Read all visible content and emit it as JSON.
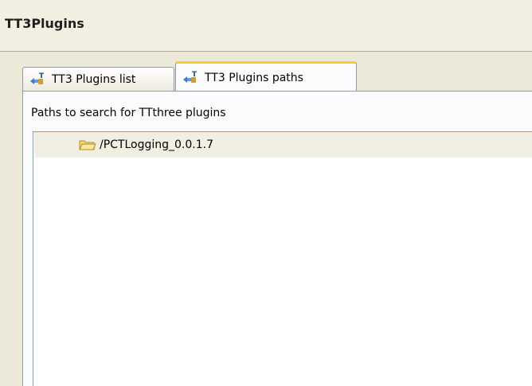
{
  "header": {
    "title": "TT3Plugins"
  },
  "tabs": [
    {
      "label": "TT3 Plugins list",
      "icon": "plugin-icon",
      "selected": false
    },
    {
      "label": "TT3 Plugins paths",
      "icon": "plugin-icon",
      "selected": true
    }
  ],
  "panel": {
    "label": "Paths to search for TTthree plugins",
    "items": [
      {
        "label": "/PCTLogging_0.0.1.7",
        "icon": "folder-icon",
        "selected": true
      }
    ]
  },
  "colors": {
    "background": "#f1efe2",
    "panel": "#fcfcfe",
    "active_tab_accent": "#ffc83c",
    "border": "#919b9c"
  }
}
